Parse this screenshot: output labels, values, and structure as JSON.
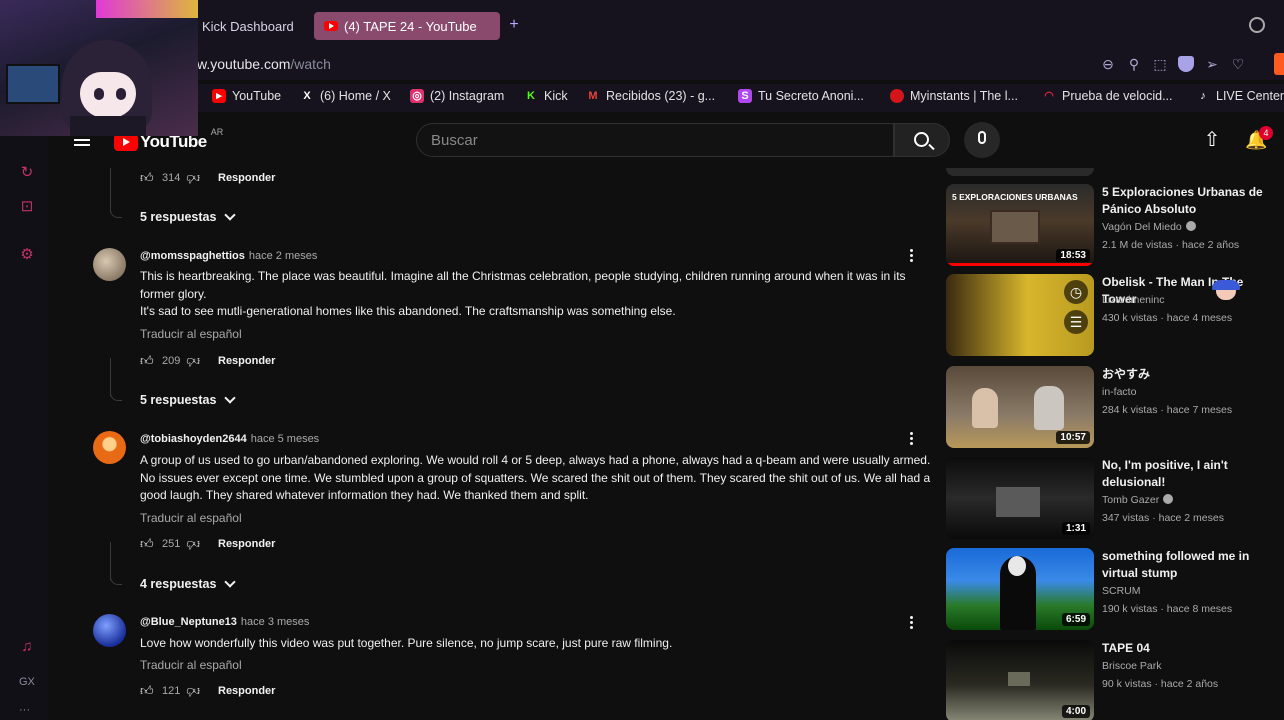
{
  "browser": {
    "tabs": [
      {
        "label": "Kick Dashboard",
        "active": false
      },
      {
        "label": "(4) TAPE 24 - YouTube",
        "active": true
      }
    ],
    "url_host": "w.youtube.com",
    "url_path": "/watch",
    "bookmarks": [
      {
        "label": "YouTube",
        "icon": "youtube-icon",
        "color": "#ff0000"
      },
      {
        "label": "(6) Home / X",
        "icon": "x-icon",
        "color": "#ffffff"
      },
      {
        "label": "(2) Instagram",
        "icon": "instagram-icon",
        "color": "#e1306c"
      },
      {
        "label": "Kick",
        "icon": "kick-icon",
        "color": "#53fc18"
      },
      {
        "label": "Recibidos (23) - g...",
        "icon": "gmail-icon",
        "color": "#ea4335"
      },
      {
        "label": "Tu Secreto Anoni...",
        "icon": "secret-icon",
        "color": "#b146f2"
      },
      {
        "label": "Myinstants | The l...",
        "icon": "myinstants-icon",
        "color": "#d4161c"
      },
      {
        "label": "Prueba de velocid...",
        "icon": "speedtest-icon",
        "color": "#e8223c"
      },
      {
        "label": "LIVE Center",
        "icon": "tiktok-icon",
        "color": "#ffffff"
      }
    ],
    "rail_label": "GX"
  },
  "youtube": {
    "logo_text": "YouTube",
    "region": "AR",
    "search_placeholder": "Buscar",
    "notification_count": "4"
  },
  "comments": {
    "prev": {
      "likes": "314",
      "reply_label": "Responder",
      "replies_label": "5 respuestas"
    },
    "items": [
      {
        "handle": "@momsspaghettios",
        "ago": "hace 2 meses",
        "lines": [
          "This is heartbreaking. The place was beautiful. Imagine all the Christmas celebration, people studying, children running around when it was in its former glory.",
          "It's sad to see mutli-generational homes like this abandoned. The craftsmanship was something else."
        ],
        "translate": "Traducir al español",
        "likes": "209",
        "reply_label": "Responder",
        "replies_label": "5 respuestas"
      },
      {
        "handle": "@tobiashoyden2644",
        "ago": "hace 5 meses",
        "lines": [
          "A group of us used to go urban/abandoned exploring. We would roll 4 or 5 deep, always had a phone, always had a q-beam and were usually armed. No issues ever except one time. We stumbled upon a group of squatters. We scared the shit out of them. They scared the shit out of us. We all had a good laugh. They shared whatever information they had. We thanked them and split."
        ],
        "translate": "Traducir al español",
        "likes": "251",
        "reply_label": "Responder",
        "replies_label": "4 respuestas"
      },
      {
        "handle": "@Blue_Neptune13",
        "ago": "hace 3 meses",
        "lines": [
          "Love how wonderfully this video was put together. Pure silence, no jump scare, just pure raw filming."
        ],
        "translate": "Traducir al español",
        "likes": "121",
        "reply_label": "Responder"
      }
    ]
  },
  "related": [
    {
      "title": "5 Exploraciones Urbanas de Pánico Absoluto",
      "channel": "Vagón Del Miedo",
      "verified": true,
      "stats": "2.1 M de vistas · hace 2 años",
      "duration": "18:53",
      "thumb_text": "5 EXPLORACIONES URBANAS",
      "watched": 1.0
    },
    {
      "title": "Obelisk - The Man In The Tower",
      "channel": "Lizardmeninc",
      "verified": false,
      "stats": "430 k vistas · hace 4 meses",
      "duration": ""
    },
    {
      "title": "おやすみ",
      "channel": "in-facto",
      "verified": false,
      "stats": "284 k vistas · hace 7 meses",
      "duration": "10:57"
    },
    {
      "title": "No, I'm positive, I ain't delusional!",
      "channel": "Tomb Gazer",
      "verified": true,
      "stats": "347 vistas · hace 2 meses",
      "duration": "1:31"
    },
    {
      "title": "something followed me in virtual stump",
      "channel": "SCRUM",
      "verified": false,
      "stats": "190 k vistas · hace 8 meses",
      "duration": "6:59"
    },
    {
      "title": "TAPE 04",
      "channel": "Briscoe Park",
      "verified": false,
      "stats": "90 k vistas · hace 2 años",
      "duration": "4:00"
    }
  ]
}
